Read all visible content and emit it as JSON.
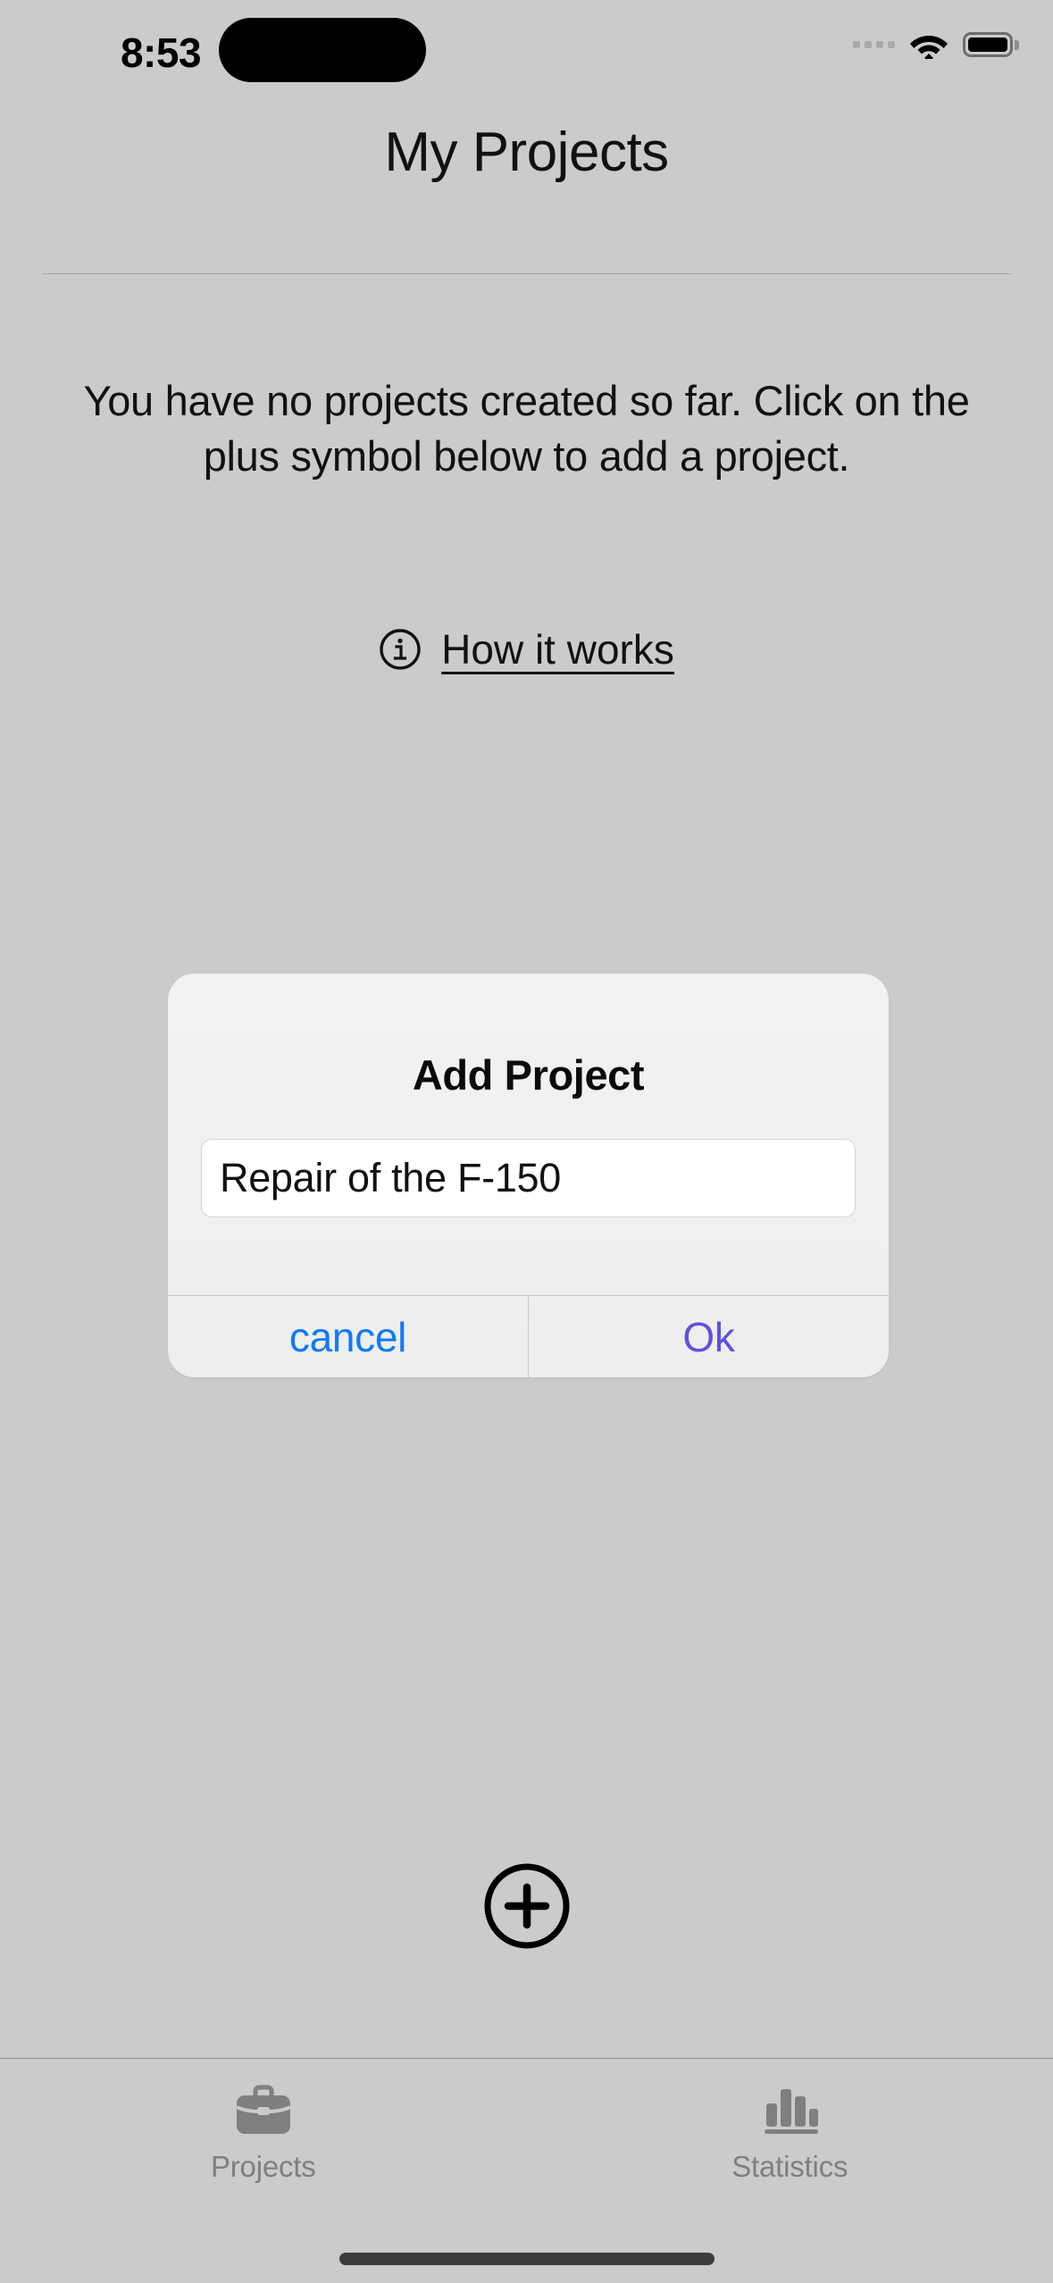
{
  "status_bar": {
    "time": "8:53",
    "signal_icon": "signal-dots-icon",
    "wifi_icon": "wifi-icon",
    "battery_icon": "battery-icon"
  },
  "header": {
    "title": "My Projects"
  },
  "empty_state": {
    "message": "You have no projects created so far. Click on the plus symbol below to add a project.",
    "link_label": "How it works",
    "link_icon": "info-circle-icon"
  },
  "dialog": {
    "title": "Add Project",
    "input_value": "Repair of the F-150",
    "input_placeholder": "",
    "cancel_label": "cancel",
    "ok_label": "Ok",
    "cancel_color": "#107af5",
    "ok_color": "#5b52e0"
  },
  "add_button": {
    "icon": "plus-circle-icon"
  },
  "tab_bar": {
    "items": [
      {
        "label": "Projects",
        "icon": "briefcase-icon"
      },
      {
        "label": "Statistics",
        "icon": "bar-chart-icon"
      }
    ],
    "inactive_color": "#7f7f7f"
  },
  "colors": {
    "background": "#cbcbcb",
    "dialog_background": "#efefee",
    "text": "#111111"
  }
}
